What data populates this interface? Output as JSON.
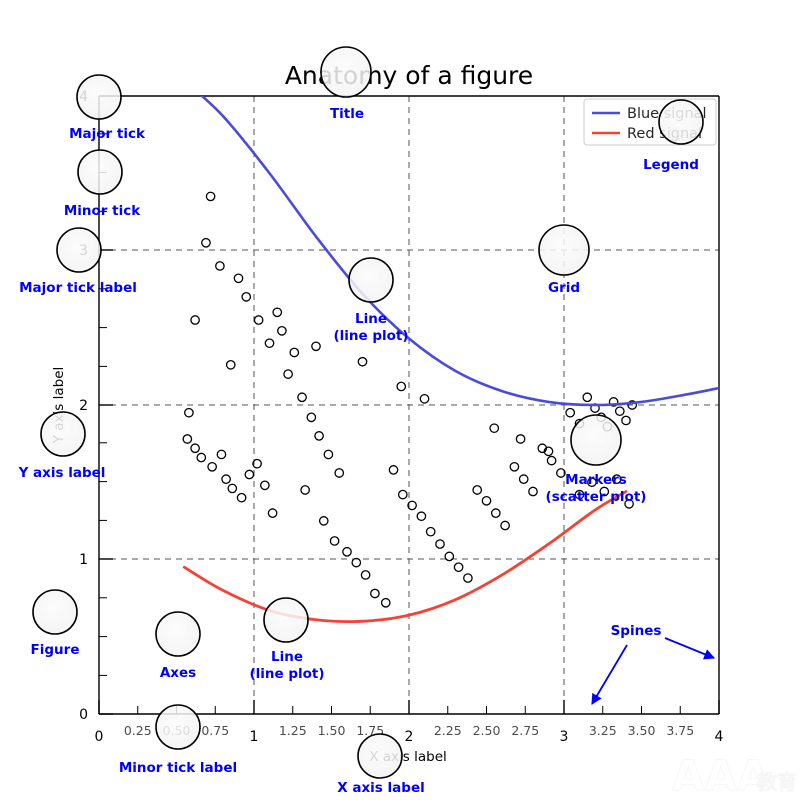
{
  "figure": {
    "title": "Anatomy of a figure",
    "x_axis_label": "X axis label",
    "y_axis_label": "Y axis label",
    "watermark": "AAA",
    "watermark_cjk": "教育",
    "background": "#ffffff",
    "blue": "#4b4bdb",
    "red": "#f44336",
    "anno_color": "#0000ff",
    "spine_color": "#000000",
    "grid_color": "#555555"
  },
  "legend": {
    "entries": [
      {
        "label": "Blue signal",
        "color": "#4b4bdb"
      },
      {
        "label": "Red signal",
        "color": "#f44336"
      }
    ]
  },
  "annotations": [
    {
      "name": "title",
      "label": "Title",
      "lines": [
        "Title"
      ]
    },
    {
      "name": "major-tick",
      "label": "Major tick",
      "lines": [
        "Major tick"
      ]
    },
    {
      "name": "minor-tick",
      "label": "Minor tick",
      "lines": [
        "Minor tick"
      ]
    },
    {
      "name": "major-tick-label",
      "label": "Major tick label",
      "lines": [
        "Major tick label"
      ]
    },
    {
      "name": "y-axis-label",
      "label": "Y axis label",
      "lines": [
        "Y axis label"
      ]
    },
    {
      "name": "figure",
      "label": "Figure",
      "lines": [
        "Figure"
      ]
    },
    {
      "name": "axes",
      "label": "Axes",
      "lines": [
        "Axes"
      ]
    },
    {
      "name": "line-plot-red",
      "label": "Line (line plot)",
      "lines": [
        "Line",
        "(line plot)"
      ]
    },
    {
      "name": "line-plot-blue",
      "label": "Line (line plot)",
      "lines": [
        "Line",
        "(line plot)"
      ]
    },
    {
      "name": "minor-tick-label",
      "label": "Minor tick label",
      "lines": [
        "Minor tick label"
      ]
    },
    {
      "name": "x-axis-label",
      "label": "X axis label",
      "lines": [
        "X axis label"
      ]
    },
    {
      "name": "legend",
      "label": "Legend",
      "lines": [
        "Legend"
      ]
    },
    {
      "name": "grid",
      "label": "Grid",
      "lines": [
        "Grid"
      ]
    },
    {
      "name": "markers",
      "label": "Markers (scatter plot)",
      "lines": [
        "Markers",
        "(scatter plot)"
      ]
    },
    {
      "name": "spines",
      "label": "Spines",
      "lines": [
        "Spines"
      ]
    }
  ],
  "anno_text": {
    "title": "Title",
    "major_tick": "Major tick",
    "minor_tick": "Minor tick",
    "major_tick_label": "Major tick label",
    "y_axis_label": "Y axis label",
    "figure": "Figure",
    "axes": "Axes",
    "line_1": "Line",
    "line_2": "(line plot)",
    "line_b1": "Line",
    "line_b2": "(line plot)",
    "minor_tick_label": "Minor tick label",
    "x_axis_label": "X axis label",
    "legend": "Legend",
    "grid": "Grid",
    "markers_1": "Markers",
    "markers_2": "(scatter plot)",
    "spines": "Spines"
  },
  "chart_data": {
    "type": "scatter",
    "title": "Anatomy of a figure",
    "xlabel": "X axis label",
    "ylabel": "Y axis label",
    "xlim": [
      0,
      4
    ],
    "ylim": [
      0,
      4
    ],
    "grid": true,
    "grid_style": "dashed",
    "legend_position": "upper right",
    "x_major_ticks": [
      0,
      1,
      2,
      3,
      4
    ],
    "x_major_tick_labels": [
      "0",
      "1",
      "2",
      "3",
      "4"
    ],
    "x_minor_ticks": [
      0.25,
      0.5,
      0.75,
      1.25,
      1.5,
      1.75,
      2.25,
      2.5,
      2.75,
      3.25,
      3.5,
      3.75
    ],
    "x_minor_tick_labels": [
      "0.25",
      "0.50",
      "0.75",
      "1.25",
      "1.50",
      "1.75",
      "2.25",
      "2.50",
      "2.75",
      "3.25",
      "3.50",
      "3.75"
    ],
    "y_major_ticks": [
      0,
      1,
      2,
      3,
      4
    ],
    "y_major_tick_labels": [
      "0",
      "1",
      "2",
      "3",
      "4"
    ],
    "y_minor_ticks": [
      0.25,
      0.5,
      0.75,
      1.25,
      1.5,
      1.75,
      2.25,
      2.5,
      2.75,
      3.25,
      3.5,
      3.75
    ],
    "series": [
      {
        "name": "Blue signal",
        "type": "line",
        "color": "#4b4bdb",
        "x": [
          0.55,
          0.8,
          1.1,
          1.4,
          1.7,
          2.0,
          2.3,
          2.6,
          2.9,
          3.2,
          3.5,
          3.8,
          4.0
        ],
        "y": [
          4.1,
          3.87,
          3.5,
          3.09,
          2.72,
          2.43,
          2.22,
          2.09,
          2.02,
          2.0,
          2.02,
          2.07,
          2.11
        ]
      },
      {
        "name": "Red signal",
        "type": "line",
        "color": "#f44336",
        "x": [
          0.55,
          0.8,
          1.1,
          1.4,
          1.7,
          2.0,
          2.3,
          2.6,
          2.9,
          3.2,
          3.4
        ],
        "y": [
          0.95,
          0.8,
          0.67,
          0.61,
          0.6,
          0.64,
          0.74,
          0.9,
          1.1,
          1.32,
          1.44
        ]
      },
      {
        "name": "Markers (scatter plot)",
        "type": "scatter",
        "marker": "open-circle",
        "edge_color": "#000000",
        "face_color": "none",
        "x": [
          0.72,
          0.69,
          0.78,
          0.62,
          0.85,
          0.58,
          0.57,
          0.62,
          0.66,
          0.73,
          0.79,
          0.82,
          0.86,
          0.92,
          0.97,
          1.02,
          1.07,
          1.12,
          0.95,
          1.03,
          1.1,
          1.18,
          1.26,
          1.22,
          1.31,
          1.37,
          1.42,
          1.48,
          1.55,
          1.33,
          1.45,
          1.52,
          1.6,
          1.66,
          1.72,
          1.78,
          1.85,
          1.9,
          1.96,
          2.02,
          2.08,
          2.14,
          2.2,
          2.26,
          2.32,
          2.38,
          2.44,
          2.5,
          2.56,
          2.62,
          2.68,
          2.74,
          2.8,
          2.86,
          2.92,
          2.98,
          3.04,
          3.1,
          3.15,
          3.2,
          3.24,
          3.28,
          3.32,
          3.36,
          3.4,
          3.44,
          3.1,
          3.18,
          3.26,
          3.34,
          2.55,
          2.72,
          2.9,
          1.95,
          2.1,
          1.7,
          1.4,
          1.15,
          0.9,
          3.42
        ],
        "y": [
          3.35,
          3.05,
          2.9,
          2.55,
          2.26,
          1.95,
          1.78,
          1.72,
          1.66,
          1.6,
          1.68,
          1.52,
          1.46,
          1.4,
          1.55,
          1.62,
          1.48,
          1.3,
          2.7,
          2.55,
          2.4,
          2.48,
          2.34,
          2.2,
          2.05,
          1.92,
          1.8,
          1.68,
          1.56,
          1.45,
          1.25,
          1.12,
          1.05,
          0.98,
          0.9,
          0.78,
          0.72,
          1.58,
          1.42,
          1.35,
          1.28,
          1.18,
          1.1,
          1.02,
          0.95,
          0.88,
          1.45,
          1.38,
          1.3,
          1.22,
          1.6,
          1.52,
          1.44,
          1.72,
          1.64,
          1.56,
          1.95,
          1.88,
          2.05,
          1.98,
          1.92,
          1.86,
          2.02,
          1.96,
          1.9,
          2.0,
          1.42,
          1.5,
          1.44,
          1.52,
          1.85,
          1.78,
          1.7,
          2.12,
          2.04,
          2.28,
          2.38,
          2.6,
          2.82,
          1.36
        ]
      }
    ]
  }
}
